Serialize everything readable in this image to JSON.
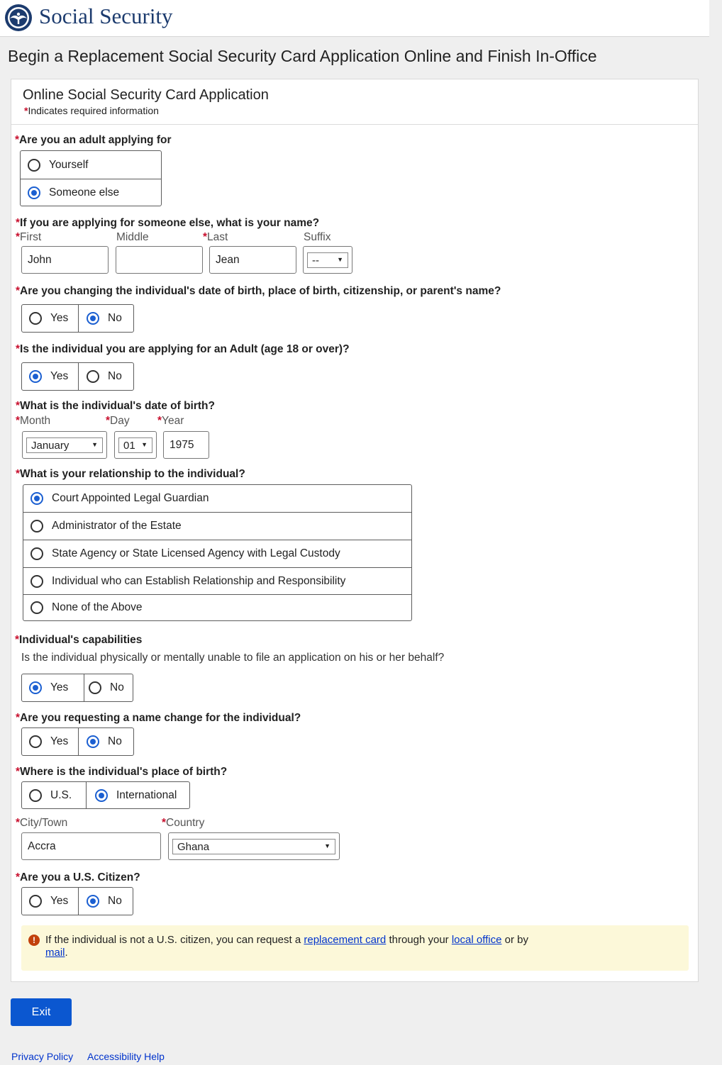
{
  "brand": "Social Security",
  "page_title": "Begin a Replacement Social Security Card Application Online and Finish In-Office",
  "panel": {
    "title": "Online Social Security Card Application",
    "required_note": "Indicates required information"
  },
  "required_marker": "*",
  "q_applying_for": {
    "label": "Are you an adult applying for",
    "options": [
      "Yourself",
      "Someone else"
    ],
    "selected": "Someone else"
  },
  "q_name": {
    "label": "If you are applying for someone else, what is your name?",
    "first_label": "First",
    "middle_label": "Middle",
    "last_label": "Last",
    "suffix_label": "Suffix",
    "first_value": "John",
    "middle_value": "",
    "last_value": "Jean",
    "suffix_value": "--"
  },
  "q_changing": {
    "label": "Are you changing the individual's date of birth, place of birth, citizenship, or parent's name?",
    "options": [
      "Yes",
      "No"
    ],
    "selected": "No"
  },
  "q_adult": {
    "label": "Is the individual you are applying for an Adult (age 18 or over)?",
    "options": [
      "Yes",
      "No"
    ],
    "selected": "Yes"
  },
  "q_dob": {
    "label": "What is the individual's date of birth?",
    "month_label": "Month",
    "day_label": "Day",
    "year_label": "Year",
    "month_value": "January",
    "day_value": "01",
    "year_value": "1975"
  },
  "q_relationship": {
    "label": "What is your relationship to the individual?",
    "options": [
      "Court Appointed Legal Guardian",
      "Administrator of the Estate",
      "State Agency or State Licensed Agency with Legal Custody",
      "Individual who can Establish Relationship and Responsibility",
      "None of the Above"
    ],
    "selected": "Court Appointed Legal Guardian"
  },
  "q_capabilities": {
    "label": "Individual's capabilities",
    "sub": "Is the individual physically or mentally unable to file an application on his or her behalf?",
    "options": [
      "Yes",
      "No"
    ],
    "selected": "Yes"
  },
  "q_name_change": {
    "label": "Are you requesting a name change for the individual?",
    "options": [
      "Yes",
      "No"
    ],
    "selected": "No"
  },
  "q_birthplace": {
    "label": "Where is the individual's place of birth?",
    "options": [
      "U.S.",
      "International"
    ],
    "selected": "International",
    "city_label": "City/Town",
    "country_label": "Country",
    "city_value": "Accra",
    "country_value": "Ghana"
  },
  "q_citizen": {
    "label": "Are you a U.S. Citizen?",
    "options": [
      "Yes",
      "No"
    ],
    "selected": "No"
  },
  "alert": {
    "icon": "!",
    "text_1": "If the individual is not a U.S. citizen, you can request a ",
    "link_1": "replacement card",
    "text_2": " through your ",
    "link_2": "local office",
    "text_3": " or by ",
    "link_3": "mail",
    "text_4": "."
  },
  "exit_label": "Exit",
  "footer": {
    "privacy": "Privacy Policy",
    "accessibility": "Accessibility Help"
  },
  "colors": {
    "accent": "#0b57d0",
    "required": "#c8102e",
    "alert_bg": "#fcf8d9",
    "link": "#0033cc"
  }
}
